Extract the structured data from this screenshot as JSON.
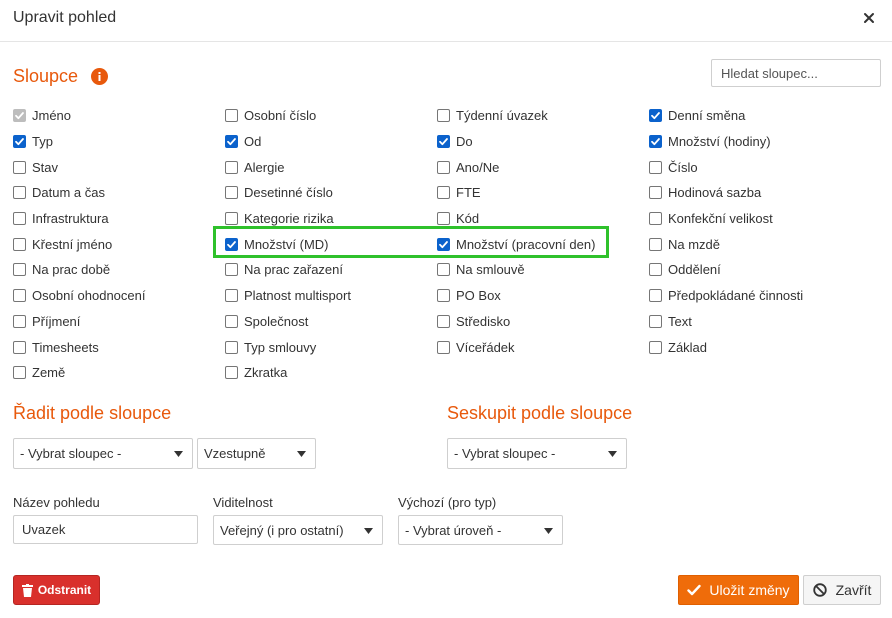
{
  "header": {
    "title": "Upravit pohled"
  },
  "columns_section": {
    "title": "Sloupce",
    "search_placeholder": "Hledat sloupec...",
    "columns": [
      [
        {
          "label": "Jméno",
          "checked": true,
          "disabled": true
        },
        {
          "label": "Typ",
          "checked": true
        },
        {
          "label": "Stav",
          "checked": false
        },
        {
          "label": "Datum a čas",
          "checked": false
        },
        {
          "label": "Infrastruktura",
          "checked": false
        },
        {
          "label": "Křestní jméno",
          "checked": false
        },
        {
          "label": "Na prac době",
          "checked": false
        },
        {
          "label": "Osobní ohodnocení",
          "checked": false
        },
        {
          "label": "Příjmení",
          "checked": false
        },
        {
          "label": "Timesheets",
          "checked": false
        },
        {
          "label": "Země",
          "checked": false
        }
      ],
      [
        {
          "label": "Osobní číslo",
          "checked": false
        },
        {
          "label": "Od",
          "checked": true
        },
        {
          "label": "Alergie",
          "checked": false
        },
        {
          "label": "Desetinné číslo",
          "checked": false
        },
        {
          "label": "Kategorie rizika",
          "checked": false
        },
        {
          "label": "Množství (MD)",
          "checked": true
        },
        {
          "label": "Na prac zařazení",
          "checked": false
        },
        {
          "label": "Platnost multisport",
          "checked": false
        },
        {
          "label": "Společnost",
          "checked": false
        },
        {
          "label": "Typ smlouvy",
          "checked": false
        },
        {
          "label": "Zkratka",
          "checked": false
        }
      ],
      [
        {
          "label": "Týdenní úvazek",
          "checked": false
        },
        {
          "label": "Do",
          "checked": true
        },
        {
          "label": "Ano/Ne",
          "checked": false
        },
        {
          "label": "FTE",
          "checked": false
        },
        {
          "label": "Kód",
          "checked": false
        },
        {
          "label": "Množství (pracovní den)",
          "checked": true
        },
        {
          "label": "Na smlouvě",
          "checked": false
        },
        {
          "label": "PO Box",
          "checked": false
        },
        {
          "label": "Středisko",
          "checked": false
        },
        {
          "label": "Víceřádek",
          "checked": false
        }
      ],
      [
        {
          "label": "Denní směna",
          "checked": true
        },
        {
          "label": "Množství (hodiny)",
          "checked": true
        },
        {
          "label": "Číslo",
          "checked": false
        },
        {
          "label": "Hodinová sazba",
          "checked": false
        },
        {
          "label": "Konfekční velikost",
          "checked": false
        },
        {
          "label": "Na mzdě",
          "checked": false
        },
        {
          "label": "Oddělení",
          "checked": false
        },
        {
          "label": "Předpokládané činnosti",
          "checked": false
        },
        {
          "label": "Text",
          "checked": false
        },
        {
          "label": "Základ",
          "checked": false
        }
      ]
    ]
  },
  "sort_section": {
    "title": "Řadit podle sloupce",
    "column_select": "- Vybrat sloupec -",
    "direction_select": "Vzestupně"
  },
  "group_section": {
    "title": "Seskupit podle sloupce",
    "column_select": "- Vybrat sloupec -"
  },
  "view_name": {
    "label": "Název pohledu",
    "value": "Uvazek"
  },
  "visibility": {
    "label": "Viditelnost",
    "value": "Veřejný (i pro ostatní)"
  },
  "default_for_type": {
    "label": "Výchozí (pro typ)",
    "value": "- Vybrat úroveň -"
  },
  "buttons": {
    "delete": "Odstranit",
    "save": "Uložit změny",
    "close": "Zavřít"
  },
  "colors": {
    "accent": "#ef6c0a",
    "danger": "#d9302c",
    "checkbox": "#0b62cc",
    "highlight": "#2fc12b"
  }
}
